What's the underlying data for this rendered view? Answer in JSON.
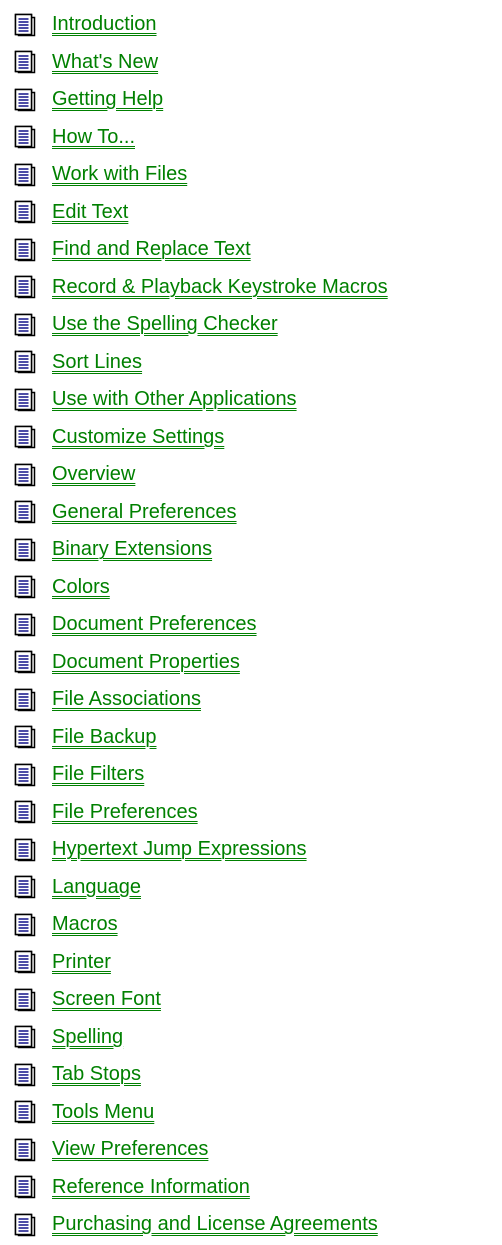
{
  "icon": "document-page-icon",
  "colors": {
    "link": "#008000",
    "background": "#ffffff"
  },
  "topics": [
    {
      "label": "Introduction"
    },
    {
      "label": "What's New"
    },
    {
      "label": "Getting Help"
    },
    {
      "label": "How To..."
    },
    {
      "label": "Work with Files"
    },
    {
      "label": "Edit Text"
    },
    {
      "label": "Find and Replace Text"
    },
    {
      "label": "Record & Playback Keystroke Macros"
    },
    {
      "label": "Use the Spelling Checker"
    },
    {
      "label": "Sort Lines"
    },
    {
      "label": "Use with Other Applications"
    },
    {
      "label": "Customize Settings"
    },
    {
      "label": "Overview"
    },
    {
      "label": "General Preferences"
    },
    {
      "label": "Binary Extensions"
    },
    {
      "label": "Colors"
    },
    {
      "label": "Document Preferences"
    },
    {
      "label": "Document Properties"
    },
    {
      "label": "File Associations"
    },
    {
      "label": "File Backup"
    },
    {
      "label": "File Filters"
    },
    {
      "label": "File Preferences"
    },
    {
      "label": "Hypertext Jump Expressions"
    },
    {
      "label": "Language"
    },
    {
      "label": "Macros"
    },
    {
      "label": "Printer"
    },
    {
      "label": "Screen Font"
    },
    {
      "label": "Spelling"
    },
    {
      "label": "Tab Stops"
    },
    {
      "label": "Tools Menu"
    },
    {
      "label": "View Preferences"
    },
    {
      "label": "Reference Information"
    },
    {
      "label": "Purchasing and License Agreements"
    }
  ]
}
